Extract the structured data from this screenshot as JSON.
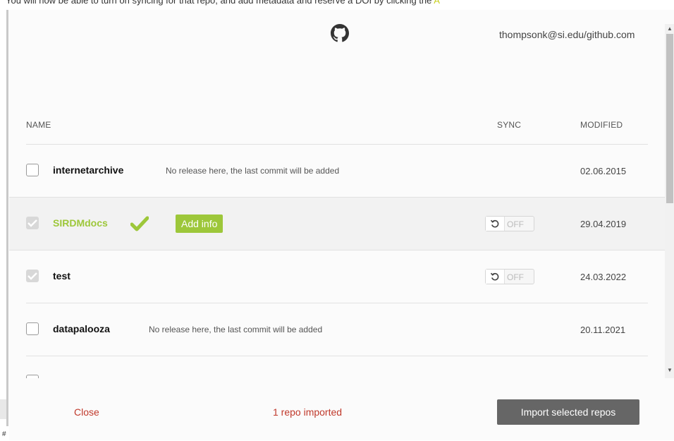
{
  "page": {
    "instruction_text": "You will now be able to turn on syncing for that repo, and add metadata and reserve a DOI by clicking the ",
    "instruction_highlight": "A"
  },
  "header": {
    "icon": "github-icon",
    "account": "thompsonk@si.edu/github.com"
  },
  "table": {
    "columns": {
      "name": "NAME",
      "sync": "SYNC",
      "modified": "MODIFIED"
    },
    "rows": [
      {
        "name": "internetarchive",
        "note": "No release here, the last commit will be added",
        "modified": "02.06.2015",
        "checked": false
      },
      {
        "name": "SIRDMdocs",
        "add_info": "Add info",
        "sync": "OFF",
        "modified": "29.04.2019",
        "checked": true,
        "imported": true
      },
      {
        "name": "test",
        "sync": "OFF",
        "modified": "24.03.2022",
        "checked": true
      },
      {
        "name": "datapalooza",
        "note": "No release here, the last commit will be added",
        "modified": "20.11.2021",
        "checked": false
      }
    ]
  },
  "footer": {
    "close": "Close",
    "status": "1 repo imported",
    "import": "Import selected repos"
  },
  "colors": {
    "accent_green": "#9dc73a",
    "danger_red": "#c0392b",
    "button_gray": "#666666"
  },
  "misc": {
    "corner_glyph": "#"
  }
}
